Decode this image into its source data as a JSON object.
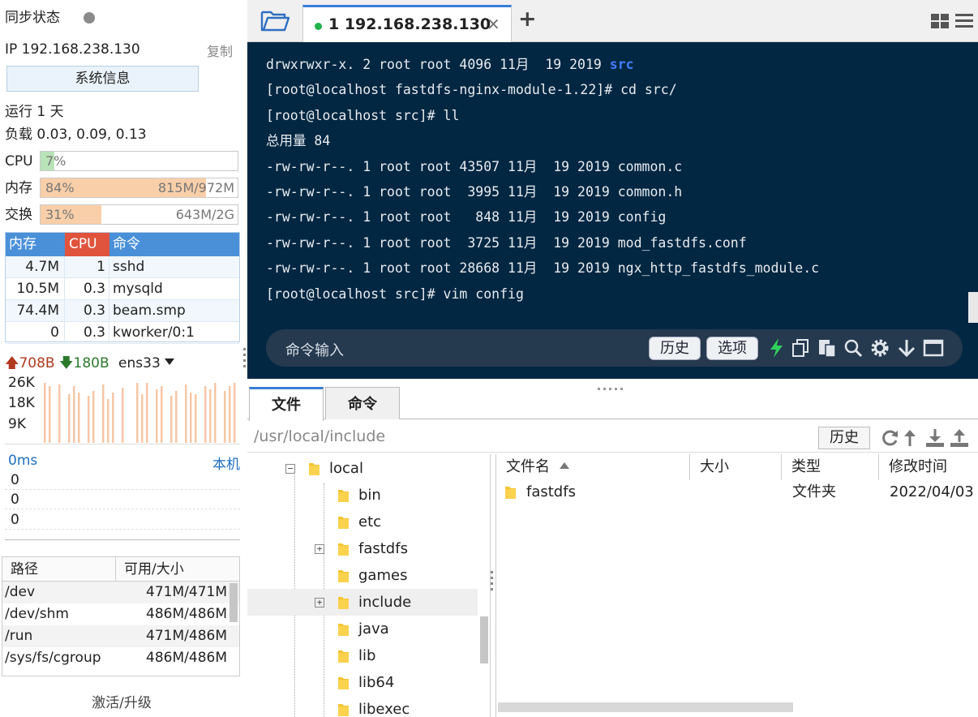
{
  "sidebar": {
    "sync_title": "同步状态",
    "ip": "IP 192.168.238.130",
    "copy_label": "复制",
    "sysinfo_label": "系统信息",
    "uptime": "运行 1 天",
    "load": "负载 0.03, 0.09, 0.13",
    "cpu": {
      "label": "CPU",
      "pct": "7%",
      "fraction": 0.07
    },
    "mem": {
      "label": "内存",
      "pct": "84%",
      "amount": "815M/972M",
      "fraction": 0.84
    },
    "swap": {
      "label": "交换",
      "pct": "31%",
      "amount": "643M/2G",
      "fraction": 0.31
    },
    "process_table": {
      "headers": [
        "内存",
        "CPU",
        "命令"
      ],
      "rows": [
        {
          "mem": "4.7M",
          "cpu": "1",
          "cmd": "sshd"
        },
        {
          "mem": "10.5M",
          "cpu": "0.3",
          "cmd": "mysqld"
        },
        {
          "mem": "74.4M",
          "cpu": "0.3",
          "cmd": "beam.smp"
        },
        {
          "mem": "0",
          "cpu": "0.3",
          "cmd": "kworker/0:1"
        }
      ]
    },
    "network": {
      "up": "708B",
      "down": "180B",
      "interface": "ens33",
      "ticks": [
        "26K",
        "18K",
        "9K"
      ]
    },
    "ping": {
      "latency": "0ms",
      "host": "本机",
      "values": [
        "0",
        "0",
        "0"
      ]
    },
    "disk_table": {
      "headers": [
        "路径",
        "可用/大小"
      ],
      "rows": [
        {
          "path": "/dev",
          "size": "471M/471M"
        },
        {
          "path": "/dev/shm",
          "size": "486M/486M"
        },
        {
          "path": "/run",
          "size": "471M/486M"
        },
        {
          "path": "/sys/fs/cgroup",
          "size": "486M/486M"
        }
      ]
    },
    "activate_label": "激活/升级"
  },
  "tabs": {
    "active_title": "1 192.168.238.130",
    "close_glyph": "×",
    "add_glyph": "+"
  },
  "terminal": {
    "lines": [
      {
        "pre": "drwxrwxr-x. 2 root root 4096 11月  19 2019 ",
        "hl": "src"
      },
      {
        "pre": "[root@localhost fastdfs-nginx-module-1.22]# cd src/",
        "hl": ""
      },
      {
        "pre": "[root@localhost src]# ll",
        "hl": ""
      },
      {
        "pre": "总用量 84",
        "hl": ""
      },
      {
        "pre": "-rw-rw-r--. 1 root root 43507 11月  19 2019 common.c",
        "hl": ""
      },
      {
        "pre": "-rw-rw-r--. 1 root root  3995 11月  19 2019 common.h",
        "hl": ""
      },
      {
        "pre": "-rw-rw-r--. 1 root root   848 11月  19 2019 config",
        "hl": ""
      },
      {
        "pre": "-rw-rw-r--. 1 root root  3725 11月  19 2019 mod_fastdfs.conf",
        "hl": ""
      },
      {
        "pre": "-rw-rw-r--. 1 root root 28668 11月  19 2019 ngx_http_fastdfs_module.c",
        "hl": ""
      },
      {
        "pre": "[root@localhost src]# vim config",
        "hl": ""
      }
    ],
    "command_placeholder": "命令输入",
    "history_label": "历史",
    "options_label": "选项"
  },
  "file_manager": {
    "tab_files": "文件",
    "tab_commands": "命令",
    "path": "/usr/local/include",
    "history_label": "历史",
    "tree": [
      {
        "label": "local",
        "level": 0,
        "toggle": "−",
        "selected": false
      },
      {
        "label": "bin",
        "level": 1,
        "toggle": "",
        "selected": false
      },
      {
        "label": "etc",
        "level": 1,
        "toggle": "",
        "selected": false
      },
      {
        "label": "fastdfs",
        "level": 1,
        "toggle": "+",
        "selected": false
      },
      {
        "label": "games",
        "level": 1,
        "toggle": "",
        "selected": false
      },
      {
        "label": "include",
        "level": 1,
        "toggle": "+",
        "selected": true
      },
      {
        "label": "java",
        "level": 1,
        "toggle": "",
        "selected": false
      },
      {
        "label": "lib",
        "level": 1,
        "toggle": "",
        "selected": false
      },
      {
        "label": "lib64",
        "level": 1,
        "toggle": "",
        "selected": false
      },
      {
        "label": "libexec",
        "level": 1,
        "toggle": "",
        "selected": false
      }
    ],
    "columns": [
      "文件名",
      "大小",
      "类型",
      "修改时间"
    ],
    "files": [
      {
        "name": "fastdfs",
        "size": "",
        "type": "文件夹",
        "modified": "2022/04/03"
      }
    ]
  },
  "colors": {
    "terminal_bg": "#022742",
    "accent": "#3a7dd8",
    "cpu_fill": "#b9e3b8",
    "mem_fill": "#f9cfa9",
    "header_blue": "#4a90d9",
    "header_red": "#e0533c"
  }
}
